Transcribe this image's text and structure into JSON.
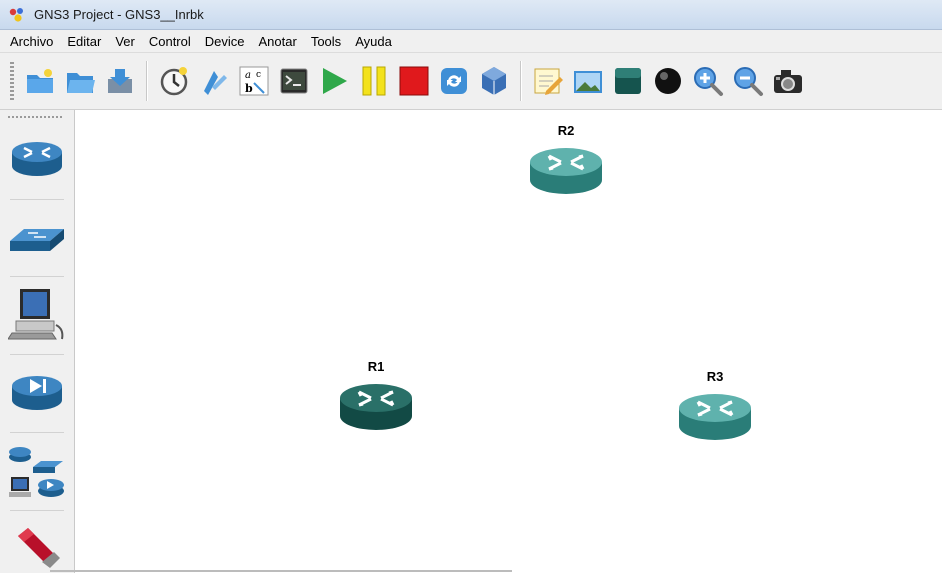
{
  "window": {
    "title": "GNS3 Project - GNS3__Inrbk"
  },
  "menu": {
    "items": [
      "Archivo",
      "Editar",
      "Ver",
      "Control",
      "Device",
      "Anotar",
      "Tools",
      "Ayuda"
    ]
  },
  "toolbar": {
    "icons": [
      "new-project-icon",
      "open-project-icon",
      "save-project-icon",
      "snapshot-icon",
      "show-interface-labels-icon",
      "console-all-icon",
      "terminal-icon",
      "start-icon",
      "suspend-icon",
      "stop-icon",
      "reload-icon",
      "virtualbox-icon",
      "add-note-icon",
      "insert-image-icon",
      "draw-rectangle-icon",
      "draw-ellipse-icon",
      "zoom-in-icon",
      "zoom-out-icon",
      "screenshot-icon"
    ]
  },
  "devices_panel": {
    "items": [
      "router-icon",
      "switch-icon",
      "end-device-icon",
      "security-device-icon",
      "all-devices-icon",
      "add-link-icon"
    ]
  },
  "canvas": {
    "nodes": [
      {
        "label": "R2",
        "color": "#3c9a96"
      },
      {
        "label": "R1",
        "color": "#1f6b64"
      },
      {
        "label": "R3",
        "color": "#3c9a96"
      }
    ]
  }
}
